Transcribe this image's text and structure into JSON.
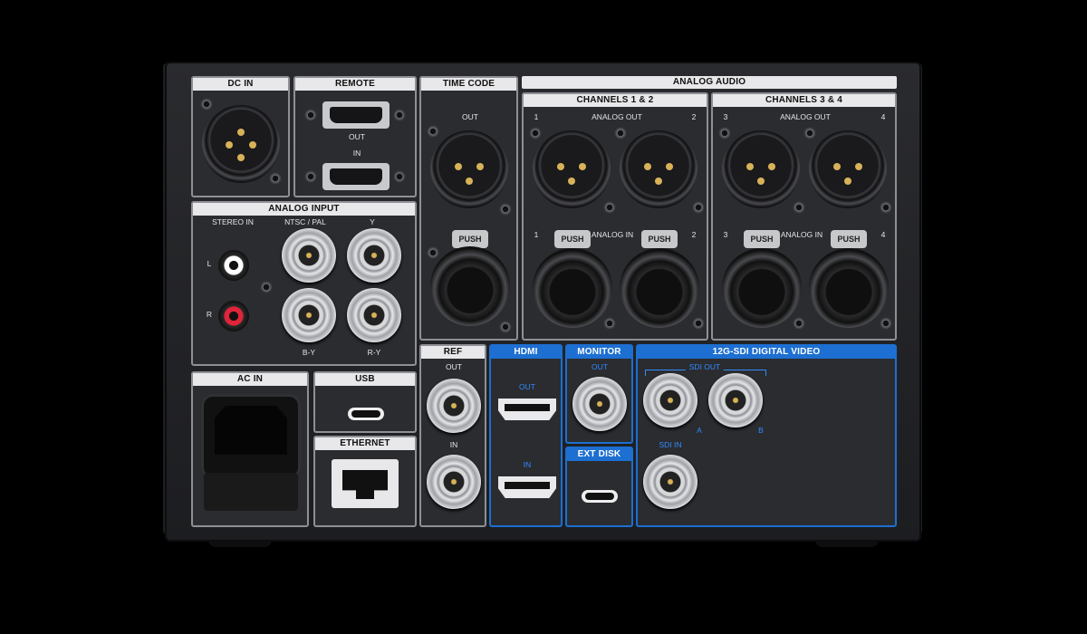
{
  "colors": {
    "accent": "#1d6fd1",
    "panel": "#2b2c30",
    "label": "#e5e5e5"
  },
  "sections": {
    "dc_in": "DC IN",
    "remote": "REMOTE",
    "time_code": "TIME CODE",
    "analog_audio": "ANALOG AUDIO",
    "channels_12": "CHANNELS 1 & 2",
    "channels_34": "CHANNELS 3 & 4",
    "analog_input": "ANALOG INPUT",
    "ac_in": "AC IN",
    "usb": "USB",
    "ethernet": "ETHERNET",
    "ref": "REF",
    "hdmi": "HDMI",
    "monitor": "MONITOR",
    "ext_disk": "EXT DISK",
    "sdi": "12G-SDI DIGITAL VIDEO"
  },
  "labels": {
    "out": "OUT",
    "in": "IN",
    "analog_out": "ANALOG OUT",
    "analog_in": "ANALOG IN",
    "ch1": "1",
    "ch2": "2",
    "ch3": "3",
    "ch4": "4",
    "stereo_in": "STEREO IN",
    "ntsc_pal": "NTSC / PAL",
    "y": "Y",
    "by": "B-Y",
    "ry": "R-Y",
    "l": "L",
    "r": "R",
    "push": "PUSH",
    "sdi_out": "SDI OUT",
    "sdi_in": "SDI IN",
    "a": "A",
    "b": "B"
  }
}
